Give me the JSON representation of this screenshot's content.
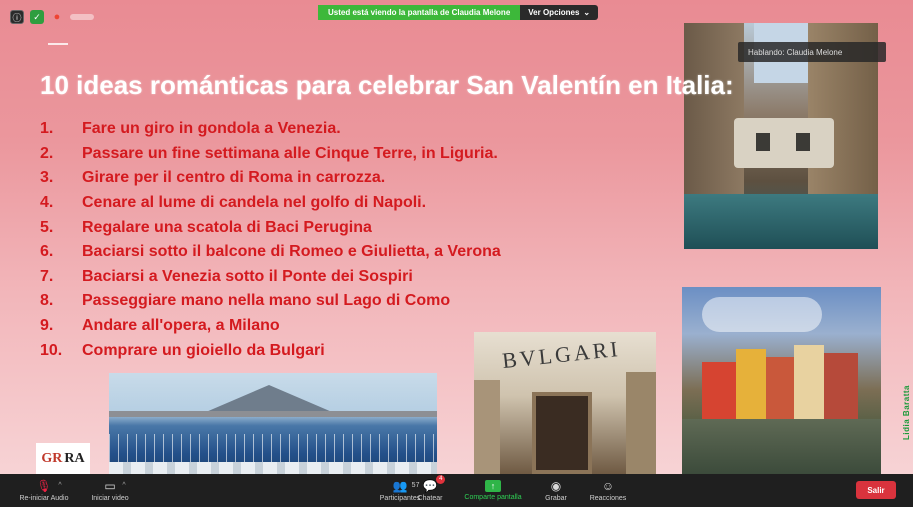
{
  "share_banner": {
    "message": "Usted está viendo la pantalla de Claudia Melone",
    "options_label": "Ver Opciones"
  },
  "speaking_label": "Hablando: Claudia Melone",
  "slide": {
    "title": "10 ideas románticas para celebrar San Valentín en Italia:",
    "ideas": [
      {
        "num": "1.",
        "text": "Fare un giro in gondola a Venezia."
      },
      {
        "num": "2.",
        "text": "Passare un fine settimana alle Cinque Terre, in Liguria."
      },
      {
        "num": "3.",
        "text": "Girare per il centro di Roma in carrozza."
      },
      {
        "num": "4.",
        "text": "Cenare al lume di candela nel golfo di Napoli."
      },
      {
        "num": "5.",
        "text": "Regalare una scatola di Baci Perugina"
      },
      {
        "num": "6.",
        "text": "Baciarsi sotto il balcone di Romeo e Giulietta, a Verona"
      },
      {
        "num": "7.",
        "text": "Baciarsi a Venezia sotto il Ponte dei Sospiri"
      },
      {
        "num": "8.",
        "text": "Passeggiare mano nella mano sul Lago di Como"
      },
      {
        "num": "9.",
        "text": "Andare all'opera, a Milano"
      },
      {
        "num": "10.",
        "text": "Comprare un gioiello da Bulgari"
      }
    ],
    "bulgari_sign": "BVLGARI",
    "logo_mark": "GR",
    "logo_text": "RA"
  },
  "side_watermark": "Lidia Baratta",
  "toolbar": {
    "audio_label": "Re-iniciar Audio",
    "video_label": "Iniciar video",
    "participants_label": "Participantes",
    "participants_count": "57",
    "chat_label": "Chatear",
    "chat_badge": "4",
    "share_label": "Comparte pantalla",
    "record_label": "Grabar",
    "reactions_label": "Reacciones",
    "exit_label": "Salir"
  },
  "colors": {
    "accent_red": "#d41a1f",
    "share_green": "#3db83a",
    "exit_red": "#d9333d"
  }
}
